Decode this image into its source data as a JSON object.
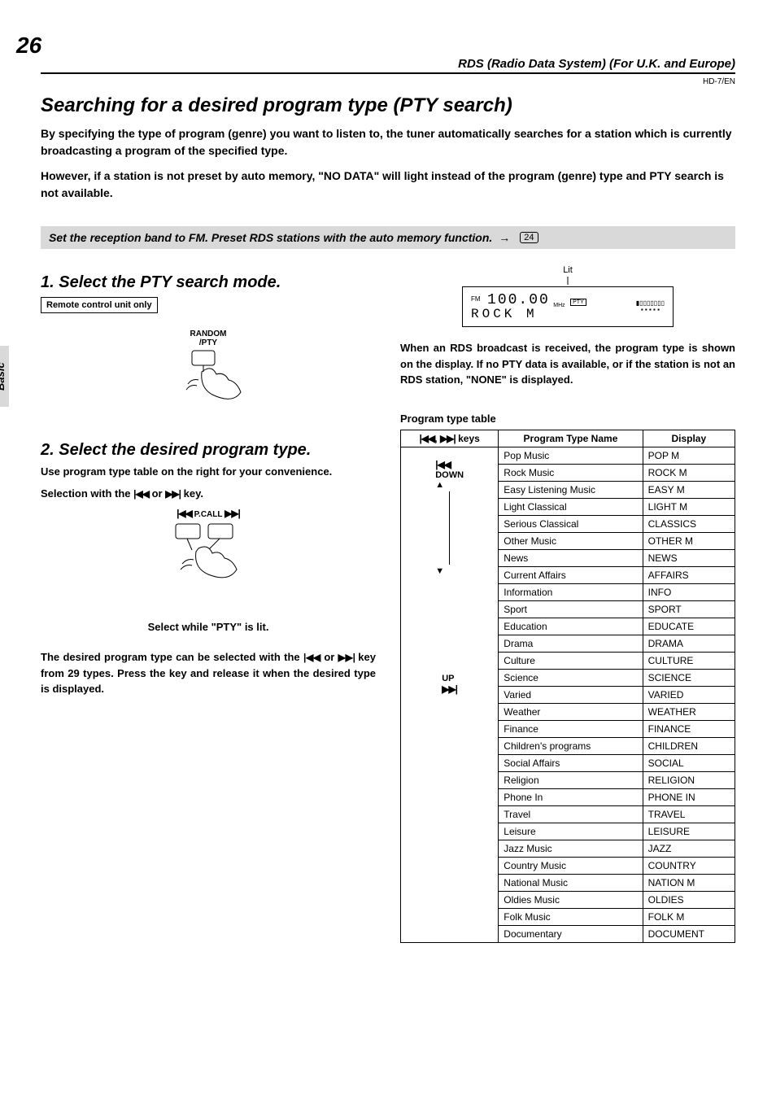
{
  "page_number": "26",
  "header_right": "RDS (Radio Data System) (For U.K. and Europe)",
  "doc_code": "HD-7/EN",
  "side_tab": "Basic",
  "section_title": "Searching for a desired program type (PTY search)",
  "intro1": "By specifying the type of program (genre) you want to listen to, the tuner automatically searches for a station which is currently broadcasting a program of the specified type.",
  "intro2": "However, if a station is not preset by auto memory, \"NO DATA\" will light instead of the program (genre) type and PTY search is not available.",
  "prep_text": "Set the reception band to FM.  Preset RDS stations with the auto memory function.",
  "prep_ref": "24",
  "step1_title": "1. Select the PTY search mode.",
  "remote_box": "Remote control unit only",
  "btn_label_top": "RANDOM",
  "btn_label_bottom": "/PTY",
  "step2_title": "2. Select the desired program type.",
  "step2_sub": "Use program type table on the right for your convenience.",
  "selection_pre": "Selection with the ",
  "selection_mid": " or ",
  "selection_post": " key.",
  "pcall_label": "P.CALL",
  "select_while": "Select while \"PTY\" is lit.",
  "desired_text_pre": "The desired program type can be selected with the ",
  "desired_text_mid": " or ",
  "desired_text_post": " key from 29 types. Press the key and release it when the desired type is displayed.",
  "lit_label": "Lit",
  "display_fm": "FM",
  "display_freq": "100.00",
  "display_mhz": "MHz",
  "display_text": "ROCK M",
  "rds_text": "When an RDS broadcast is received, the program type is shown on the display. If no PTY data is available, or if the station is not an RDS station, \"NONE\" is displayed.",
  "table_title": "Program type table",
  "table_headers": {
    "keys": "keys",
    "name": "Program Type Name",
    "display": "Display"
  },
  "key_down": "DOWN",
  "key_up": "UP",
  "rows": [
    {
      "name": "Pop Music",
      "disp": "POP M"
    },
    {
      "name": "Rock Music",
      "disp": "ROCK M"
    },
    {
      "name": "Easy Listening Music",
      "disp": "EASY M"
    },
    {
      "name": "Light Classical",
      "disp": "LIGHT M"
    },
    {
      "name": "Serious Classical",
      "disp": "CLASSICS"
    },
    {
      "name": "Other Music",
      "disp": "OTHER M"
    },
    {
      "name": "News",
      "disp": "NEWS"
    },
    {
      "name": "Current Affairs",
      "disp": "AFFAIRS"
    },
    {
      "name": "Information",
      "disp": "INFO"
    },
    {
      "name": "Sport",
      "disp": "SPORT"
    },
    {
      "name": "Education",
      "disp": "EDUCATE"
    },
    {
      "name": "Drama",
      "disp": "DRAMA"
    },
    {
      "name": "Culture",
      "disp": "CULTURE"
    },
    {
      "name": "Science",
      "disp": "SCIENCE"
    },
    {
      "name": "Varied",
      "disp": "VARIED"
    },
    {
      "name": "Weather",
      "disp": "WEATHER"
    },
    {
      "name": "Finance",
      "disp": "FINANCE"
    },
    {
      "name": "Children's programs",
      "disp": "CHILDREN"
    },
    {
      "name": "Social Affairs",
      "disp": "SOCIAL"
    },
    {
      "name": "Religion",
      "disp": "RELIGION"
    },
    {
      "name": "Phone In",
      "disp": "PHONE IN"
    },
    {
      "name": "Travel",
      "disp": "TRAVEL"
    },
    {
      "name": "Leisure",
      "disp": "LEISURE"
    },
    {
      "name": "Jazz Music",
      "disp": "JAZZ"
    },
    {
      "name": "Country Music",
      "disp": "COUNTRY"
    },
    {
      "name": "National Music",
      "disp": "NATION M"
    },
    {
      "name": "Oldies Music",
      "disp": "OLDIES"
    },
    {
      "name": "Folk Music",
      "disp": "FOLK M"
    },
    {
      "name": "Documentary",
      "disp": "DOCUMENT"
    }
  ]
}
